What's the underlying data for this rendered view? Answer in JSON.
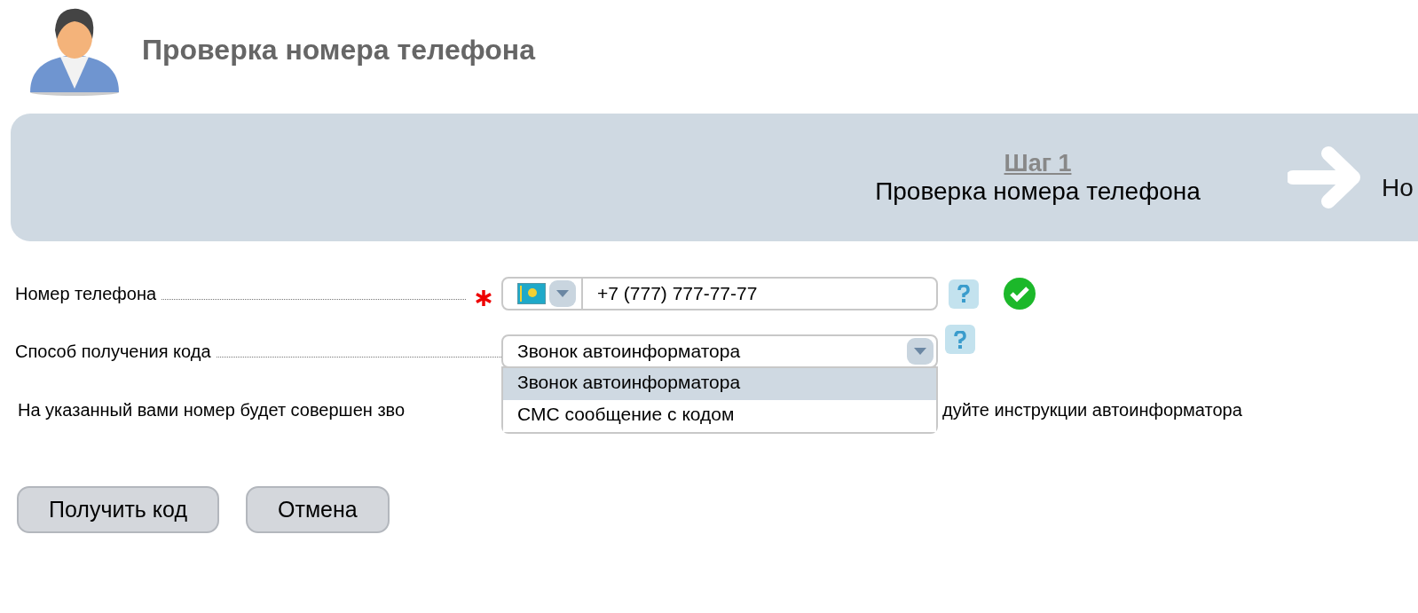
{
  "page_title": "Проверка номера телефона",
  "steps": [
    {
      "label": "Шаг 1",
      "name": "Проверка номера телефона",
      "selected": true
    },
    {
      "name": "Но",
      "selected": false
    }
  ],
  "phone": {
    "label": "Номер телефона",
    "required": true,
    "value": "+7 (777) 777-77-77",
    "valid": true
  },
  "code_method": {
    "label": "Способ получения кода",
    "value": "Звонок автоинформатора",
    "expanded": true,
    "options": [
      {
        "label": "Звонок автоинформатора",
        "selected": true
      },
      {
        "label": "СМС сообщение с кодом",
        "selected": false
      }
    ]
  },
  "info": {
    "left": "На указанный вами номер будет совершен зво",
    "right": "дуйте инструкции автоинформатора"
  },
  "buttons": [
    "Получить код",
    "Отмена"
  ]
}
